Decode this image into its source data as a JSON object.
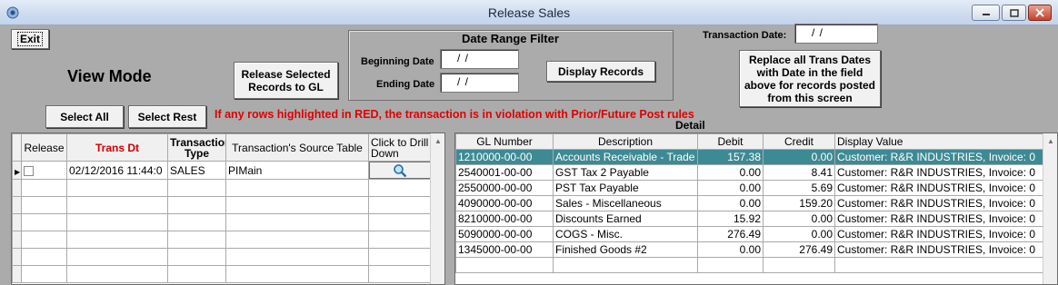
{
  "window": {
    "title": "Release Sales",
    "icon": "app-logo-icon"
  },
  "toolbar": {
    "exit_label": "Exit",
    "view_mode": "View Mode",
    "release_label": "Release Selected Records to GL",
    "select_all_label": "Select All",
    "select_rest_label": "Select Rest",
    "warning": "If any rows highlighted in RED, the transaction is in violation with Prior/Future Post rules"
  },
  "date_filter": {
    "title": "Date Range Filter",
    "beginning_label": "Beginning Date",
    "beginning_value": "/ /",
    "ending_label": "Ending Date",
    "ending_value": "/ /",
    "display_label": "Display Records"
  },
  "transaction": {
    "label": "Transaction Date:",
    "value": "/ /",
    "replace_label": "Replace all Trans Dates with Date in the field above for records posted from this screen"
  },
  "left_table": {
    "headers": [
      "Release",
      "Trans Dt",
      "Transaction Type",
      "Transaction's Source Table",
      "Click to Drill Down"
    ],
    "rows": [
      {
        "trans_dt": "02/12/2016 11:44:0",
        "type": "SALES",
        "source": "PIMain"
      }
    ]
  },
  "detail": {
    "label": "Detail",
    "headers": [
      "GL Number",
      "Description",
      "Debit",
      "Credit",
      "Display Value"
    ],
    "rows": [
      {
        "gl": "1210000-00-00",
        "desc": "Accounts Receivable - Trade",
        "debit": "157.38",
        "credit": "0.00",
        "display": "Customer: R&R INDUSTRIES, Invoice: 0"
      },
      {
        "gl": "2540001-00-00",
        "desc": "GST Tax 2 Payable",
        "debit": "0.00",
        "credit": "8.41",
        "display": "Customer: R&R INDUSTRIES, Invoice: 0"
      },
      {
        "gl": "2550000-00-00",
        "desc": "PST Tax Payable",
        "debit": "0.00",
        "credit": "5.69",
        "display": "Customer: R&R INDUSTRIES, Invoice: 0"
      },
      {
        "gl": "4090000-00-00",
        "desc": "Sales - Miscellaneous",
        "debit": "0.00",
        "credit": "159.20",
        "display": "Customer: R&R INDUSTRIES, Invoice: 0"
      },
      {
        "gl": "8210000-00-00",
        "desc": "Discounts Earned",
        "debit": "15.92",
        "credit": "0.00",
        "display": "Customer: R&R INDUSTRIES, Invoice: 0"
      },
      {
        "gl": "5090000-00-00",
        "desc": "COGS - Misc.",
        "debit": "276.49",
        "credit": "0.00",
        "display": "Customer: R&R INDUSTRIES, Invoice: 0"
      },
      {
        "gl": "1345000-00-00",
        "desc": "Finished Goods #2",
        "debit": "0.00",
        "credit": "276.49",
        "display": "Customer: R&R INDUSTRIES, Invoice: 0"
      }
    ]
  },
  "colors": {
    "highlight": "#3e8a94",
    "warning": "#e00000",
    "background": "#ababab"
  }
}
